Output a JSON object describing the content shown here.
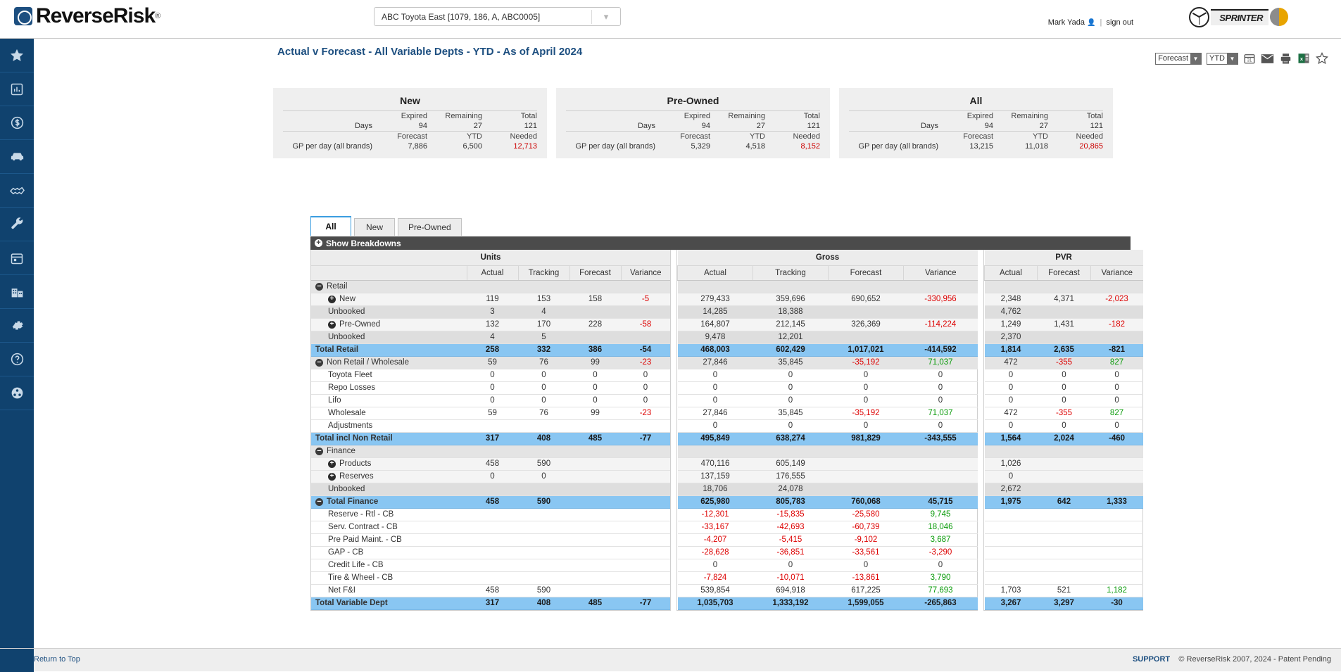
{
  "header": {
    "logo_text": "ReverseRisk",
    "logo_registered": "®",
    "dealer_value": "ABC Toyota East [1079, 186, A, ABC0005]",
    "user_name": "Mark Yada",
    "sign_out": "sign out",
    "brand_logo_text": "SPRINTER"
  },
  "sidebar": {
    "items": [
      {
        "name": "favorites",
        "icon": "star-icon"
      },
      {
        "name": "reports",
        "icon": "bar-chart-icon"
      },
      {
        "name": "finance",
        "icon": "dollar-circle-icon"
      },
      {
        "name": "vehicles",
        "icon": "car-icon"
      },
      {
        "name": "deals",
        "icon": "handshake-icon"
      },
      {
        "name": "service",
        "icon": "wrench-icon"
      },
      {
        "name": "calendar",
        "icon": "calendar-icon"
      },
      {
        "name": "dealership",
        "icon": "building-icon"
      },
      {
        "name": "settings",
        "icon": "gear-icon"
      },
      {
        "name": "help",
        "icon": "question-circle-icon"
      },
      {
        "name": "community",
        "icon": "globe-people-icon"
      }
    ]
  },
  "page": {
    "title": "Actual v Forecast - All Variable Depts - YTD - As of April 2024"
  },
  "toolbar": {
    "view_select": "Forecast",
    "period_select": "YTD",
    "icons": [
      {
        "name": "calendar-icon",
        "label": "31"
      },
      {
        "name": "email-icon",
        "label": ""
      },
      {
        "name": "print-icon",
        "label": ""
      },
      {
        "name": "excel-export-icon",
        "label": "x"
      },
      {
        "name": "favorite-star-icon",
        "label": ""
      }
    ]
  },
  "cards": [
    {
      "title": "New",
      "days_label": "Days",
      "gp_label": "GP per day (all brands)",
      "col1_a": "Expired",
      "col2_a": "Remaining",
      "col3_a": "Total",
      "days": [
        "94",
        "27",
        "121"
      ],
      "col1_b": "Forecast",
      "col2_b": "YTD",
      "col3_b": "Needed",
      "gp": [
        "7,886",
        "6,500",
        "12,713"
      ]
    },
    {
      "title": "Pre-Owned",
      "days_label": "Days",
      "gp_label": "GP per day (all brands)",
      "col1_a": "Expired",
      "col2_a": "Remaining",
      "col3_a": "Total",
      "days": [
        "94",
        "27",
        "121"
      ],
      "col1_b": "Forecast",
      "col2_b": "YTD",
      "col3_b": "Needed",
      "gp": [
        "5,329",
        "4,518",
        "8,152"
      ]
    },
    {
      "title": "All",
      "days_label": "Days",
      "gp_label": "GP per day (all brands)",
      "col1_a": "Expired",
      "col2_a": "Remaining",
      "col3_a": "Total",
      "days": [
        "94",
        "27",
        "121"
      ],
      "col1_b": "Forecast",
      "col2_b": "YTD",
      "col3_b": "Needed",
      "gp": [
        "13,215",
        "11,018",
        "20,865"
      ]
    }
  ],
  "tabs": [
    {
      "label": "All",
      "active": true
    },
    {
      "label": "New",
      "active": false
    },
    {
      "label": "Pre-Owned",
      "active": false
    }
  ],
  "breakdown_label": "Show Breakdowns",
  "grid": {
    "groups": {
      "units": "Units",
      "gross": "Gross",
      "pvr": "PVR"
    },
    "units_cols": [
      "Actual",
      "Tracking",
      "Forecast",
      "Variance"
    ],
    "gross_cols": [
      "Actual",
      "Tracking",
      "Forecast",
      "Variance"
    ],
    "pvr_cols": [
      "Actual",
      "Forecast",
      "Variance"
    ],
    "rows": [
      {
        "label": "Retail",
        "style": "group",
        "toggle": "minus",
        "indent": 0,
        "units": [
          "",
          "",
          "",
          ""
        ],
        "gross": [
          "",
          "",
          "",
          ""
        ],
        "pvr": [
          "",
          "",
          ""
        ]
      },
      {
        "label": "New",
        "style": "alt",
        "toggle": "plus",
        "indent": 1,
        "units": [
          "119",
          "153",
          "158",
          "-5"
        ],
        "gross": [
          "279,433",
          "359,696",
          "690,652",
          "-330,956"
        ],
        "pvr": [
          "2,348",
          "4,371",
          "-2,023"
        ]
      },
      {
        "label": "Unbooked",
        "style": "shade",
        "toggle": "",
        "indent": 1,
        "units": [
          "3",
          "4",
          "",
          ""
        ],
        "gross": [
          "14,285",
          "18,388",
          "",
          ""
        ],
        "pvr": [
          "4,762",
          "",
          ""
        ]
      },
      {
        "label": "Pre-Owned",
        "style": "alt",
        "toggle": "plus",
        "indent": 1,
        "units": [
          "132",
          "170",
          "228",
          "-58"
        ],
        "gross": [
          "164,807",
          "212,145",
          "326,369",
          "-114,224"
        ],
        "pvr": [
          "1,249",
          "1,431",
          "-182"
        ]
      },
      {
        "label": "Unbooked",
        "style": "shade",
        "toggle": "",
        "indent": 1,
        "units": [
          "4",
          "5",
          "",
          ""
        ],
        "gross": [
          "9,478",
          "12,201",
          "",
          ""
        ],
        "pvr": [
          "2,370",
          "",
          ""
        ]
      },
      {
        "label": "Total Retail",
        "style": "total",
        "toggle": "",
        "indent": 0,
        "units": [
          "258",
          "332",
          "386",
          "-54"
        ],
        "gross": [
          "468,003",
          "602,429",
          "1,017,021",
          "-414,592"
        ],
        "pvr": [
          "1,814",
          "2,635",
          "-821"
        ]
      },
      {
        "label": "Non Retail / Wholesale",
        "style": "group",
        "toggle": "minus",
        "indent": 0,
        "units": [
          "59",
          "76",
          "99",
          "-23"
        ],
        "gross": [
          "27,846",
          "35,845",
          "-35,192",
          "71,037"
        ],
        "pvr": [
          "472",
          "-355",
          "827"
        ]
      },
      {
        "label": "Toyota Fleet",
        "style": "plain",
        "toggle": "",
        "indent": 1,
        "units": [
          "0",
          "0",
          "0",
          "0"
        ],
        "gross": [
          "0",
          "0",
          "0",
          "0"
        ],
        "pvr": [
          "0",
          "0",
          "0"
        ]
      },
      {
        "label": "Repo Losses",
        "style": "plain",
        "toggle": "",
        "indent": 1,
        "units": [
          "0",
          "0",
          "0",
          "0"
        ],
        "gross": [
          "0",
          "0",
          "0",
          "0"
        ],
        "pvr": [
          "0",
          "0",
          "0"
        ]
      },
      {
        "label": "Lifo",
        "style": "plain",
        "toggle": "",
        "indent": 1,
        "units": [
          "0",
          "0",
          "0",
          "0"
        ],
        "gross": [
          "0",
          "0",
          "0",
          "0"
        ],
        "pvr": [
          "0",
          "0",
          "0"
        ]
      },
      {
        "label": "Wholesale",
        "style": "plain",
        "toggle": "",
        "indent": 1,
        "units": [
          "59",
          "76",
          "99",
          "-23"
        ],
        "gross": [
          "27,846",
          "35,845",
          "-35,192",
          "71,037"
        ],
        "pvr": [
          "472",
          "-355",
          "827"
        ]
      },
      {
        "label": "Adjustments",
        "style": "plain",
        "toggle": "",
        "indent": 1,
        "units": [
          "",
          "",
          "",
          ""
        ],
        "gross": [
          "0",
          "0",
          "0",
          "0"
        ],
        "pvr": [
          "0",
          "0",
          "0"
        ]
      },
      {
        "label": "Total incl Non Retail",
        "style": "total",
        "toggle": "",
        "indent": 0,
        "units": [
          "317",
          "408",
          "485",
          "-77"
        ],
        "gross": [
          "495,849",
          "638,274",
          "981,829",
          "-343,555"
        ],
        "pvr": [
          "1,564",
          "2,024",
          "-460"
        ]
      },
      {
        "label": "Finance",
        "style": "group",
        "toggle": "minus",
        "indent": 0,
        "units": [
          "",
          "",
          "",
          ""
        ],
        "gross": [
          "",
          "",
          "",
          ""
        ],
        "pvr": [
          "",
          "",
          ""
        ]
      },
      {
        "label": "Products",
        "style": "alt",
        "toggle": "plus",
        "indent": 1,
        "units": [
          "458",
          "590",
          "",
          ""
        ],
        "gross": [
          "470,116",
          "605,149",
          "",
          ""
        ],
        "pvr": [
          "1,026",
          "",
          ""
        ]
      },
      {
        "label": "Reserves",
        "style": "alt",
        "toggle": "plus",
        "indent": 1,
        "units": [
          "0",
          "0",
          "",
          ""
        ],
        "gross": [
          "137,159",
          "176,555",
          "",
          ""
        ],
        "pvr": [
          "0",
          "",
          ""
        ]
      },
      {
        "label": "Unbooked",
        "style": "shade",
        "toggle": "",
        "indent": 1,
        "units": [
          "",
          "",
          "",
          ""
        ],
        "gross": [
          "18,706",
          "24,078",
          "",
          ""
        ],
        "pvr": [
          "2,672",
          "",
          ""
        ]
      },
      {
        "label": "Total Finance",
        "style": "total",
        "toggle": "minus",
        "indent": 0,
        "units": [
          "458",
          "590",
          "",
          ""
        ],
        "gross": [
          "625,980",
          "805,783",
          "760,068",
          "45,715"
        ],
        "pvr": [
          "1,975",
          "642",
          "1,333"
        ]
      },
      {
        "label": "Reserve - Rtl - CB",
        "style": "plain",
        "toggle": "",
        "indent": 1,
        "units": [
          "",
          "",
          "",
          ""
        ],
        "gross": [
          "-12,301",
          "-15,835",
          "-25,580",
          "9,745"
        ],
        "pvr": [
          "",
          "",
          ""
        ]
      },
      {
        "label": "Serv. Contract - CB",
        "style": "plain",
        "toggle": "",
        "indent": 1,
        "units": [
          "",
          "",
          "",
          ""
        ],
        "gross": [
          "-33,167",
          "-42,693",
          "-60,739",
          "18,046"
        ],
        "pvr": [
          "",
          "",
          ""
        ]
      },
      {
        "label": "Pre Paid Maint. - CB",
        "style": "plain",
        "toggle": "",
        "indent": 1,
        "units": [
          "",
          "",
          "",
          ""
        ],
        "gross": [
          "-4,207",
          "-5,415",
          "-9,102",
          "3,687"
        ],
        "pvr": [
          "",
          "",
          ""
        ]
      },
      {
        "label": "GAP - CB",
        "style": "plain",
        "toggle": "",
        "indent": 1,
        "units": [
          "",
          "",
          "",
          ""
        ],
        "gross": [
          "-28,628",
          "-36,851",
          "-33,561",
          "-3,290"
        ],
        "pvr": [
          "",
          "",
          ""
        ]
      },
      {
        "label": "Credit Life - CB",
        "style": "plain",
        "toggle": "",
        "indent": 1,
        "units": [
          "",
          "",
          "",
          ""
        ],
        "gross": [
          "0",
          "0",
          "0",
          "0"
        ],
        "pvr": [
          "",
          "",
          ""
        ]
      },
      {
        "label": "Tire & Wheel - CB",
        "style": "plain",
        "toggle": "",
        "indent": 1,
        "units": [
          "",
          "",
          "",
          ""
        ],
        "gross": [
          "-7,824",
          "-10,071",
          "-13,861",
          "3,790"
        ],
        "pvr": [
          "",
          "",
          ""
        ]
      },
      {
        "label": "Net F&I",
        "style": "plain",
        "toggle": "",
        "indent": 1,
        "units": [
          "458",
          "590",
          "",
          ""
        ],
        "gross": [
          "539,854",
          "694,918",
          "617,225",
          "77,693"
        ],
        "pvr": [
          "1,703",
          "521",
          "1,182"
        ]
      },
      {
        "label": "Total Variable Dept",
        "style": "total",
        "toggle": "",
        "indent": 0,
        "units": [
          "317",
          "408",
          "485",
          "-77"
        ],
        "gross": [
          "1,035,703",
          "1,333,192",
          "1,599,055",
          "-265,863"
        ],
        "pvr": [
          "3,267",
          "3,297",
          "-30"
        ]
      }
    ]
  },
  "footer": {
    "return_to_top": "Return to Top",
    "support": "SUPPORT",
    "copyright": "© ReverseRisk 2007, 2024 - Patent Pending"
  },
  "colors": {
    "brand_blue": "#10426e",
    "title_blue": "#1d4f80",
    "total_row": "#89c6f2",
    "negative": "#dd0000",
    "positive": "#0a9b0a"
  }
}
